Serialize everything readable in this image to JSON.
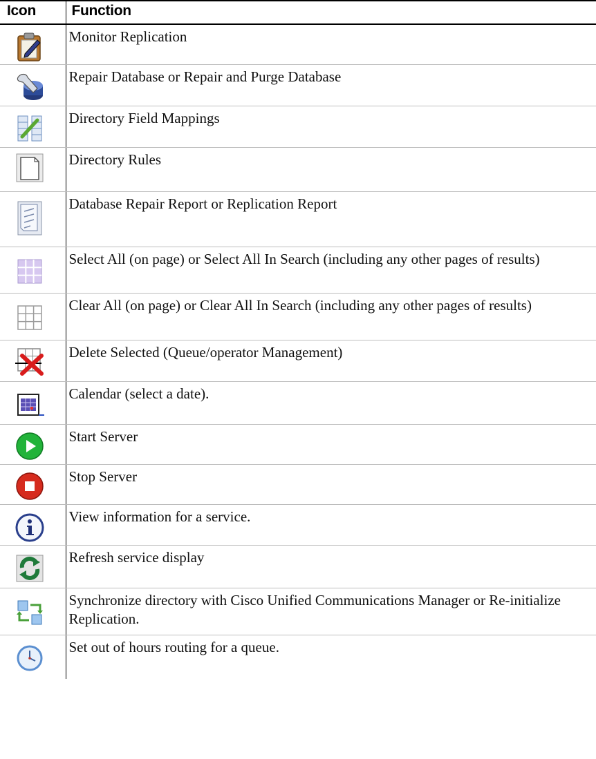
{
  "header": {
    "icon": "Icon",
    "function": "Function"
  },
  "rows": [
    {
      "icon": "clipboard-edit-icon",
      "label": " Monitor Replication"
    },
    {
      "icon": "wrench-database-icon",
      "label": "Repair Database or Repair and Purge Database"
    },
    {
      "icon": "field-mapping-icon",
      "label": "Directory Field Mappings"
    },
    {
      "icon": "document-page-icon",
      "label": "Directory Rules"
    },
    {
      "icon": "report-document-icon",
      "label": "Database Repair Report or Replication Report"
    },
    {
      "icon": "select-all-grid-icon",
      "label": "Select All (on page) or Select All In Search (including any other pages of results)"
    },
    {
      "icon": "clear-all-grid-icon",
      "label": "Clear All (on page) or Clear All In Search (including any other pages of results)"
    },
    {
      "icon": "delete-grid-icon",
      "label": "Delete Selected (Queue/operator Management)"
    },
    {
      "icon": "calendar-icon",
      "label": "Calendar (select a date)."
    },
    {
      "icon": "play-icon",
      "label": "Start Server"
    },
    {
      "icon": "stop-icon",
      "label": "Stop Server"
    },
    {
      "icon": "info-icon",
      "label": "View information for a service."
    },
    {
      "icon": "refresh-icon",
      "label": "Refresh service display"
    },
    {
      "icon": "sync-icon",
      "label": "Synchronize directory with Cisco Unified Communications Manager or Re-initialize Replication."
    },
    {
      "icon": "clock-icon",
      "label": "Set out of hours routing for a queue."
    }
  ]
}
